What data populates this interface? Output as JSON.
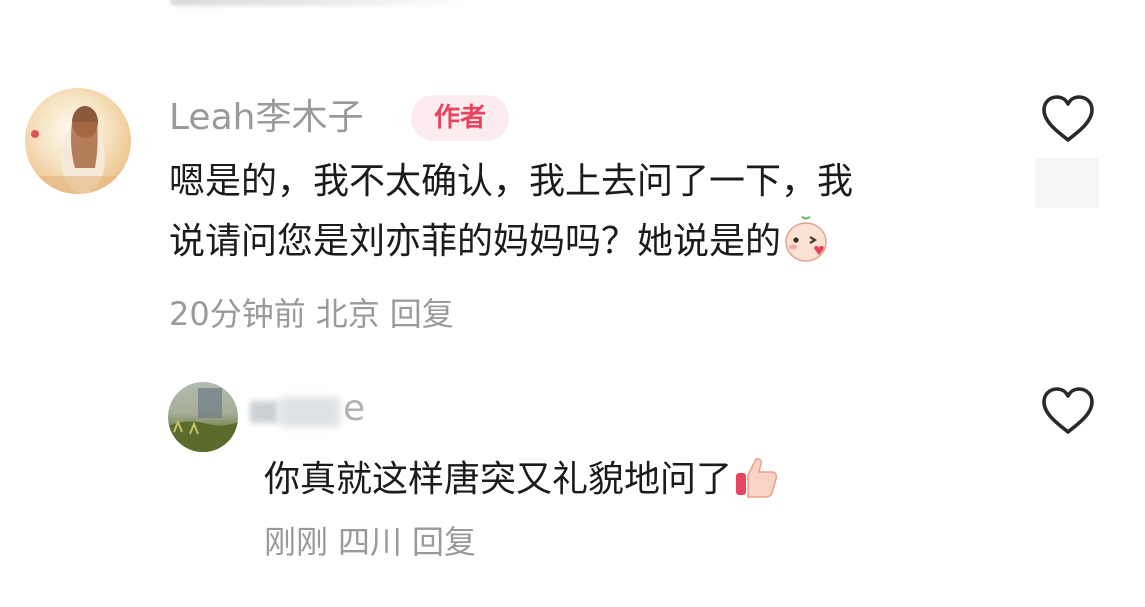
{
  "comments": [
    {
      "username": "Leah李木子",
      "badge": "作者",
      "text_lines": [
        "嗯是的，我不太确认，我上去问了一下，我",
        "说请问您是刘亦菲的妈妈吗？她说是的"
      ],
      "emoji": "kiss-heart-emoji",
      "meta": {
        "time": "20分钟前",
        "location": "北京",
        "reply_label": "回复"
      },
      "like_icon": "heart-outline-icon"
    },
    {
      "username_visible": "e",
      "text": "你真就这样唐突又礼貌地问了",
      "emoji": "thumbs-up-emoji",
      "meta": {
        "time": "刚刚",
        "location": "四川",
        "reply_label": "回复"
      },
      "like_icon": "heart-outline-icon"
    }
  ],
  "colors": {
    "badge_text": "#e8435f",
    "badge_bg": "#fdecef",
    "meta_gray": "#9a9a9a",
    "body_text": "#1b1b1b"
  }
}
